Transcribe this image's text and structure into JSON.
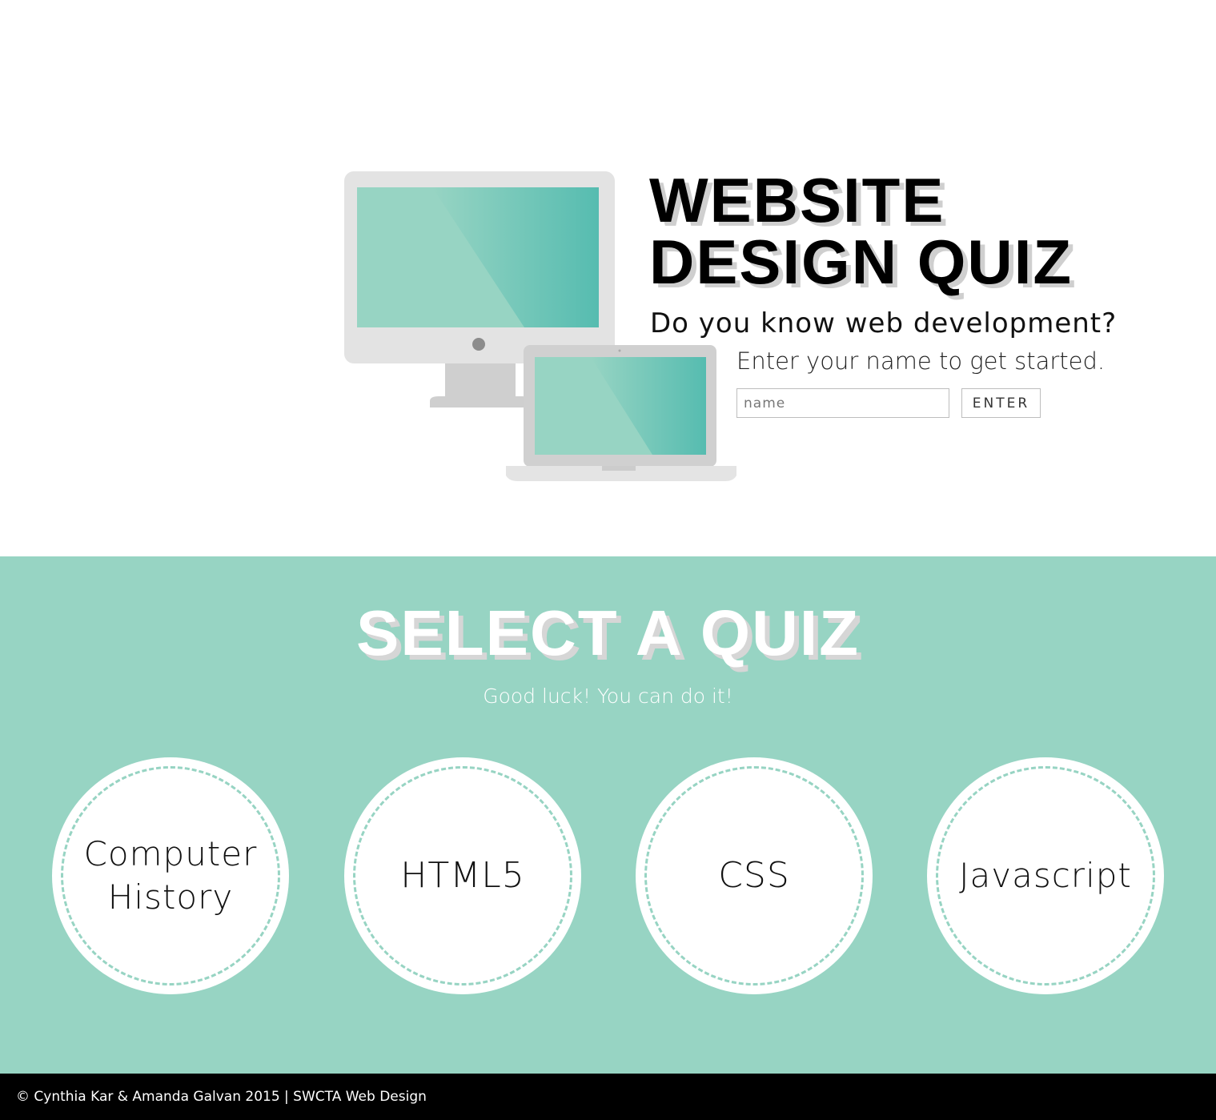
{
  "hero": {
    "title_line1": "WEBSITE",
    "title_line2": "DESIGN QUIZ",
    "subtitle": "Do you know web development?",
    "prompt": "Enter your name to get started.",
    "name_placeholder": "name",
    "enter_label": "ENTER"
  },
  "quiz": {
    "heading": "SELECT A QUIZ",
    "tagline": "Good luck! You can do it!",
    "options": [
      {
        "line1": "Computer",
        "line2": "History"
      },
      {
        "label": "HTML5"
      },
      {
        "label": "CSS"
      },
      {
        "label": "Javascript"
      }
    ]
  },
  "footer": {
    "text": "© Cynthia Kar & Amanda Galvan 2015 | SWCTA Web Design"
  },
  "colors": {
    "accent": "#97d4c3",
    "footer_bg": "#000000",
    "text_dark": "#000000"
  },
  "icons": [
    "desktop-monitor-icon",
    "laptop-icon"
  ]
}
